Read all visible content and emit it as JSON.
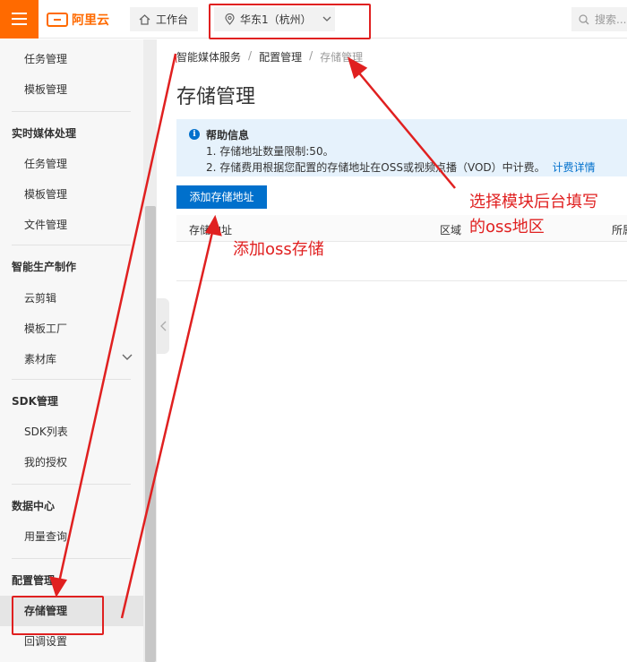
{
  "header": {
    "logo_text": "阿里云",
    "workbench_label": "工作台",
    "region_label": "华东1（杭州）",
    "search_placeholder": "搜索..."
  },
  "sidebar": {
    "items": [
      {
        "label": "任务管理"
      },
      {
        "label": "模板管理"
      },
      {
        "group": "实时媒体处理"
      },
      {
        "label": "任务管理"
      },
      {
        "label": "模板管理"
      },
      {
        "label": "文件管理"
      },
      {
        "group": "智能生产制作"
      },
      {
        "label": "云剪辑"
      },
      {
        "label": "模板工厂"
      },
      {
        "label": "素材库"
      },
      {
        "group": "SDK管理"
      },
      {
        "label": "SDK列表"
      },
      {
        "label": "我的授权"
      },
      {
        "group": "数据中心"
      },
      {
        "label": "用量查询"
      },
      {
        "group": "配置管理"
      },
      {
        "label": "存储管理",
        "active": true
      },
      {
        "label": "回调设置"
      }
    ]
  },
  "breadcrumb": [
    "智能媒体服务",
    "配置管理",
    "存储管理"
  ],
  "page_title": "存储管理",
  "help": {
    "title": "帮助信息",
    "line1": "1. 存储地址数量限制:50。",
    "line2": "2. 存储费用根据您配置的存储地址在OSS或视频点播（VOD）中计费。",
    "link": "计费详情"
  },
  "add_button": "添加存储地址",
  "table": {
    "columns": [
      "存储地址",
      "区域",
      "所属"
    ]
  },
  "annotations": {
    "region_note_line1": "选择模块后台填写",
    "region_note_line2": "的oss地区",
    "add_note": "添加oss存储"
  },
  "colors": {
    "brand_orange": "#ff6a00",
    "primary_blue": "#0070cc",
    "annotation_red": "#e02020"
  }
}
